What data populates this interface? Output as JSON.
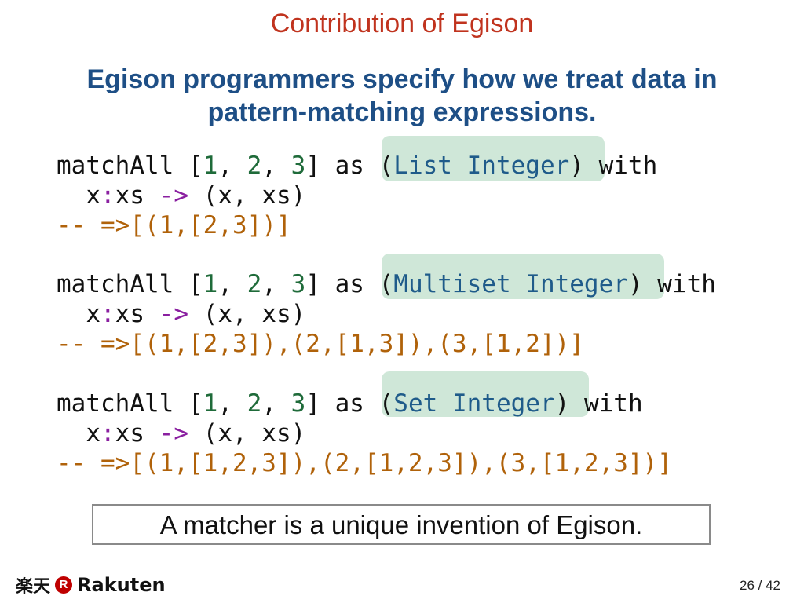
{
  "slide": {
    "title": "Contribution of Egison",
    "subtitle_line1": "Egison programmers specify how we treat data in",
    "subtitle_line2": "pattern-matching expressions.",
    "note": "A matcher is a unique invention of Egison.",
    "page": "26 / 42"
  },
  "code": {
    "kw_matchall": "matchAll",
    "kw_as": "as",
    "kw_with": "with",
    "pattern_x": "x",
    "pattern_colon": ":",
    "pattern_xs": "xs",
    "arrow": "->",
    "body": "(x, xs)",
    "num1": "1",
    "num2": "2",
    "num3": "3",
    "blocks": [
      {
        "type_name": "List",
        "result": "-- =>[(1,[2,3])]"
      },
      {
        "type_name": "Multiset",
        "result": "-- =>[(1,[2,3]),(2,[1,3]),(3,[1,2])]"
      },
      {
        "type_name": "Set",
        "result": "-- =>[(1,[1,2,3]),(2,[1,2,3]),(3,[1,2,3])]"
      }
    ],
    "type_integer": "Integer"
  },
  "footer": {
    "logo_jp": "楽天",
    "logo_r": "R",
    "logo_en": "Rakuten"
  },
  "colors": {
    "title": "#c0331e",
    "subtitle": "#1e4f86",
    "number": "#1f6b3a",
    "operator": "#8a1fa0",
    "type": "#1f5b8a",
    "result": "#b0620a",
    "highlight": "#cfe7d8"
  }
}
